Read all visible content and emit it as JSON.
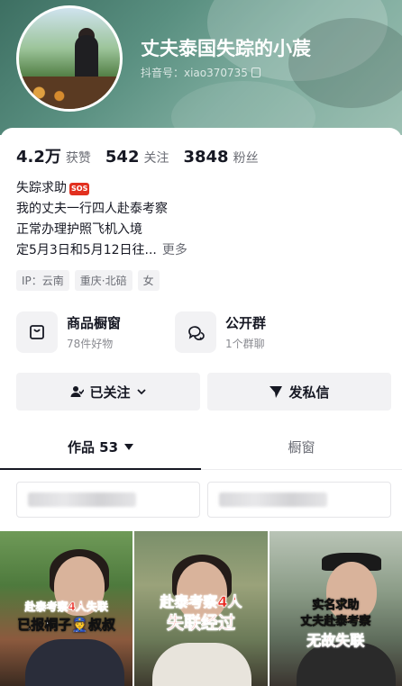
{
  "profile": {
    "nickname": "丈夫泰国失踪的小莀",
    "douyin_id": "抖音号：xiao370735"
  },
  "stats": [
    {
      "value": "4.2万",
      "label": "获赞"
    },
    {
      "value": "542",
      "label": "关注"
    },
    {
      "value": "3848",
      "label": "粉丝"
    }
  ],
  "bio": {
    "line1": "失踪求助",
    "sos_badge": "SOS",
    "line2": "我的丈夫一行四人赴泰考察",
    "line3": "正常办理护照飞机入境",
    "line4": "定5月3日和5月12日往...",
    "more": "更多"
  },
  "tags": [
    "IP：云南",
    "重庆·北碚",
    "女"
  ],
  "entries": {
    "shop": {
      "title": "商品橱窗",
      "sub": "78件好物",
      "icon": "shopping-bag-icon"
    },
    "group": {
      "title": "公开群",
      "sub": "1个群聊",
      "icon": "chat-bubbles-icon"
    }
  },
  "actions": {
    "follow_label": "已关注",
    "message_label": "发私信"
  },
  "tabs": {
    "works": "作品 53",
    "showcase": "橱窗"
  },
  "videos": [
    {
      "cap1": "赴泰考察4人失联",
      "cap2": "已报桐子👮叔叔"
    },
    {
      "cap1": "赴泰考察4人",
      "cap2": "失联经过"
    },
    {
      "cap1": "实名求助",
      "cap2": "丈夫赴泰考察",
      "cap3": "无故失联"
    }
  ],
  "colors": {
    "accent_text": "#161823",
    "muted_text": "#6b6d75",
    "chip_bg": "#f2f2f4",
    "sos_red": "#e2301f",
    "header_teal": "#5a9081"
  }
}
